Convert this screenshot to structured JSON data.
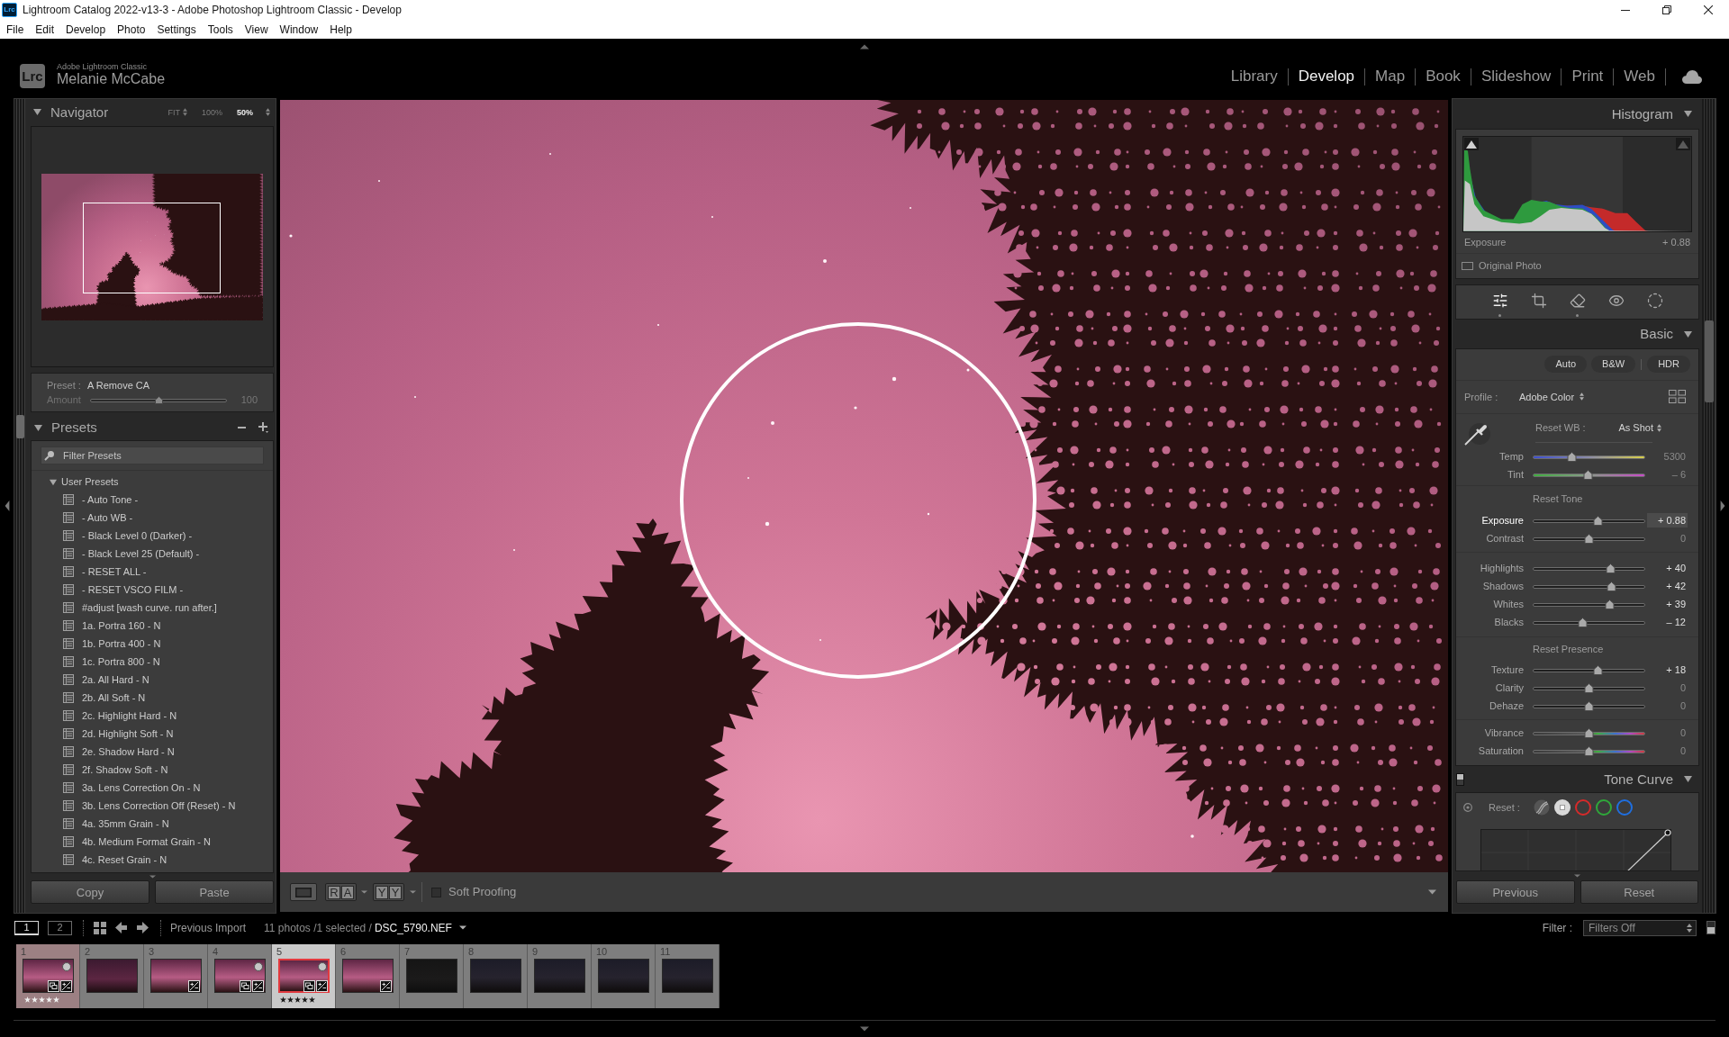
{
  "window": {
    "app_icon_text": "Lrc",
    "title": "Lightroom Catalog 2022-v13-3 - Adobe Photoshop Lightroom Classic - Develop"
  },
  "menu": [
    "File",
    "Edit",
    "Develop",
    "Photo",
    "Settings",
    "Tools",
    "View",
    "Window",
    "Help"
  ],
  "identity": {
    "logo_text": "Lrc",
    "product": "Adobe Lightroom Classic",
    "user": "Melanie McCabe"
  },
  "modules": [
    {
      "label": "Library",
      "selected": false
    },
    {
      "label": "Develop",
      "selected": true
    },
    {
      "label": "Map",
      "selected": false
    },
    {
      "label": "Book",
      "selected": false
    },
    {
      "label": "Slideshow",
      "selected": false
    },
    {
      "label": "Print",
      "selected": false
    },
    {
      "label": "Web",
      "selected": false
    }
  ],
  "navigator": {
    "title": "Navigator",
    "expanded": true,
    "zoom_options": [
      {
        "label": "FIT",
        "selected": false
      },
      {
        "label": "100%",
        "selected": false
      },
      {
        "label": "50%",
        "selected": true
      }
    ]
  },
  "preset_amount": {
    "preset_label": "Preset :",
    "preset": "A Remove CA",
    "amount_label": "Amount",
    "level": 0.5,
    "reading": "100"
  },
  "presets": {
    "title": "Presets",
    "expanded": true,
    "filter": {
      "placeholder": "Filter Presets"
    },
    "groups": [
      {
        "label": "User Presets",
        "expanded": true,
        "children": [
          {
            "label": "- Auto Tone -"
          },
          {
            "label": "- Auto WB -"
          },
          {
            "label": "- Black Level 0 (Darker) -"
          },
          {
            "label": "- Black Level 25 (Default) -"
          },
          {
            "label": "- RESET ALL -"
          },
          {
            "label": "- RESET VSCO FILM -"
          },
          {
            "label": "#adjust [wash curve. run after.]"
          },
          {
            "label": "1a. Portra 160 - N"
          },
          {
            "label": "1b. Portra 400 - N"
          },
          {
            "label": "1c. Portra 800 - N"
          },
          {
            "label": "2a. All Hard - N"
          },
          {
            "label": "2b. All Soft - N"
          },
          {
            "label": "2c. Highlight Hard - N"
          },
          {
            "label": "2d. Highlight Soft - N"
          },
          {
            "label": "2e. Shadow Hard - N"
          },
          {
            "label": "2f. Shadow Soft - N"
          },
          {
            "label": "3a. Lens Correction On - N"
          },
          {
            "label": "3b. Lens Correction Off (Reset) - N"
          },
          {
            "label": "4a. 35mm Grain - N"
          },
          {
            "label": "4b. Medium Format Grain - N"
          },
          {
            "label": "4c. Reset Grain - N"
          }
        ]
      }
    ]
  },
  "panel_buttons_left": [
    "Copy",
    "Paste"
  ],
  "toolbar": {
    "before_after_horizontal": [
      "R",
      "A"
    ],
    "before_after_vertical": [
      "Y",
      "Y"
    ],
    "soft_proofing": {
      "label": "Soft Proofing",
      "checked": false
    }
  },
  "histogram": {
    "title": "Histogram",
    "expanded": true,
    "reading_label": "Exposure",
    "reading": "+ 0.88",
    "original_photo": {
      "label": "Original Photo",
      "checked": false
    }
  },
  "tools": [
    {
      "kind": "sliders",
      "selected": true,
      "dot": true
    },
    {
      "kind": "crop",
      "selected": false,
      "dot": false
    },
    {
      "kind": "eraser",
      "selected": false,
      "dot": true
    },
    {
      "kind": "eye",
      "selected": false,
      "dot": false
    },
    {
      "kind": "mask",
      "selected": false,
      "dot": false
    }
  ],
  "basic": {
    "title": "Basic",
    "expanded": true,
    "treatments": [
      "Auto",
      "B&W",
      "HDR"
    ],
    "profile_label": "Profile :",
    "profile": "Adobe Color",
    "white_balance": {
      "reset_label": "Reset WB :",
      "value": "As Shot",
      "sliders": [
        {
          "label": "Temp",
          "kind": "temp",
          "level": 0.35,
          "reading": "5300",
          "active": false,
          "adjusted": false
        },
        {
          "label": "Tint",
          "kind": "tint",
          "level": 0.49,
          "reading": "– 6",
          "active": false,
          "adjusted": false
        }
      ]
    },
    "tone": {
      "reset_label": "Reset Tone",
      "groups": [
        {
          "sliders": [
            {
              "label": "Exposure",
              "kind": "plain",
              "level": 0.58,
              "reading": "+ 0.88",
              "active": true,
              "adjusted": true
            },
            {
              "label": "Contrast",
              "kind": "plain",
              "level": 0.5,
              "reading": "0",
              "active": false,
              "adjusted": false
            }
          ]
        },
        {
          "sliders": [
            {
              "label": "Highlights",
              "kind": "plain",
              "level": 0.69,
              "reading": "+ 40",
              "active": false,
              "adjusted": true
            },
            {
              "label": "Shadows",
              "kind": "plain",
              "level": 0.7,
              "reading": "+ 42",
              "active": false,
              "adjusted": true
            },
            {
              "label": "Whites",
              "kind": "plain",
              "level": 0.68,
              "reading": "+ 39",
              "active": false,
              "adjusted": true
            },
            {
              "label": "Blacks",
              "kind": "plain",
              "level": 0.445,
              "reading": "– 12",
              "active": false,
              "adjusted": true
            }
          ]
        }
      ]
    },
    "presence": {
      "reset_label": "Reset Presence",
      "groups": [
        {
          "sliders": [
            {
              "label": "Texture",
              "kind": "plain",
              "level": 0.58,
              "reading": "+ 18",
              "active": false,
              "adjusted": true
            },
            {
              "label": "Clarity",
              "kind": "plain",
              "level": 0.5,
              "reading": "0",
              "active": false,
              "adjusted": false
            },
            {
              "label": "Dehaze",
              "kind": "plain",
              "level": 0.5,
              "reading": "0",
              "active": false,
              "adjusted": false
            }
          ]
        },
        {
          "sliders": [
            {
              "label": "Vibrance",
              "kind": "color",
              "level": 0.5,
              "reading": "0",
              "active": false,
              "adjusted": false
            },
            {
              "label": "Saturation",
              "kind": "color",
              "level": 0.5,
              "reading": "0",
              "active": false,
              "adjusted": false
            }
          ]
        }
      ]
    }
  },
  "tone_curve": {
    "title": "Tone Curve",
    "expanded": true,
    "enabled": true,
    "reset_label": "Reset :",
    "channels": [
      {
        "kind": "parametric",
        "selected": false
      },
      {
        "kind": "point",
        "selected": true
      },
      {
        "kind": "channel",
        "color": "#d62a2a",
        "selected": false
      },
      {
        "kind": "channel",
        "color": "#2fa83a",
        "selected": false
      },
      {
        "kind": "channel",
        "color": "#1f6fe0",
        "selected": false
      }
    ]
  },
  "panel_buttons_right": [
    "Previous",
    "Reset"
  ],
  "filmstrip_bar": {
    "screens": [
      {
        "label": "1",
        "selected": true
      },
      {
        "label": "2",
        "selected": false
      }
    ],
    "source": "Previous Import",
    "count": "11 photos /1 selected /",
    "file": "DSC_5790.NEF",
    "filter_label": "Filter :",
    "filter": "Filters Off"
  },
  "filmstrip": [
    {
      "number": "1",
      "selected": false,
      "kind": "pink",
      "color": "#9c8083",
      "quick_collection": true,
      "copy_badge": true,
      "edit_badge": true,
      "stars": 5
    },
    {
      "number": "2",
      "selected": false,
      "kind": "dusk",
      "quick_collection": false,
      "copy_badge": false,
      "edit_badge": false
    },
    {
      "number": "3",
      "selected": false,
      "kind": "pink",
      "quick_collection": false,
      "copy_badge": false,
      "edit_badge": true
    },
    {
      "number": "4",
      "selected": false,
      "kind": "pink",
      "quick_collection": true,
      "copy_badge": true,
      "edit_badge": true
    },
    {
      "number": "5",
      "selected": true,
      "kind": "pink",
      "quick_collection": true,
      "copy_badge": true,
      "edit_badge": true,
      "stars": 5
    },
    {
      "number": "6",
      "selected": false,
      "kind": "pink",
      "quick_collection": false,
      "copy_badge": false,
      "edit_badge": true
    },
    {
      "number": "7",
      "selected": false,
      "kind": "dark",
      "quick_collection": false,
      "copy_badge": false,
      "edit_badge": false
    },
    {
      "number": "8",
      "selected": false,
      "kind": "night",
      "quick_collection": false,
      "copy_badge": false,
      "edit_badge": false
    },
    {
      "number": "9",
      "selected": false,
      "kind": "night",
      "quick_collection": false,
      "copy_badge": false,
      "edit_badge": false
    },
    {
      "number": "10",
      "selected": false,
      "kind": "night",
      "quick_collection": false,
      "copy_badge": false,
      "edit_badge": false
    },
    {
      "number": "11",
      "selected": false,
      "kind": "night",
      "quick_collection": false,
      "copy_badge": false,
      "edit_badge": false
    }
  ]
}
